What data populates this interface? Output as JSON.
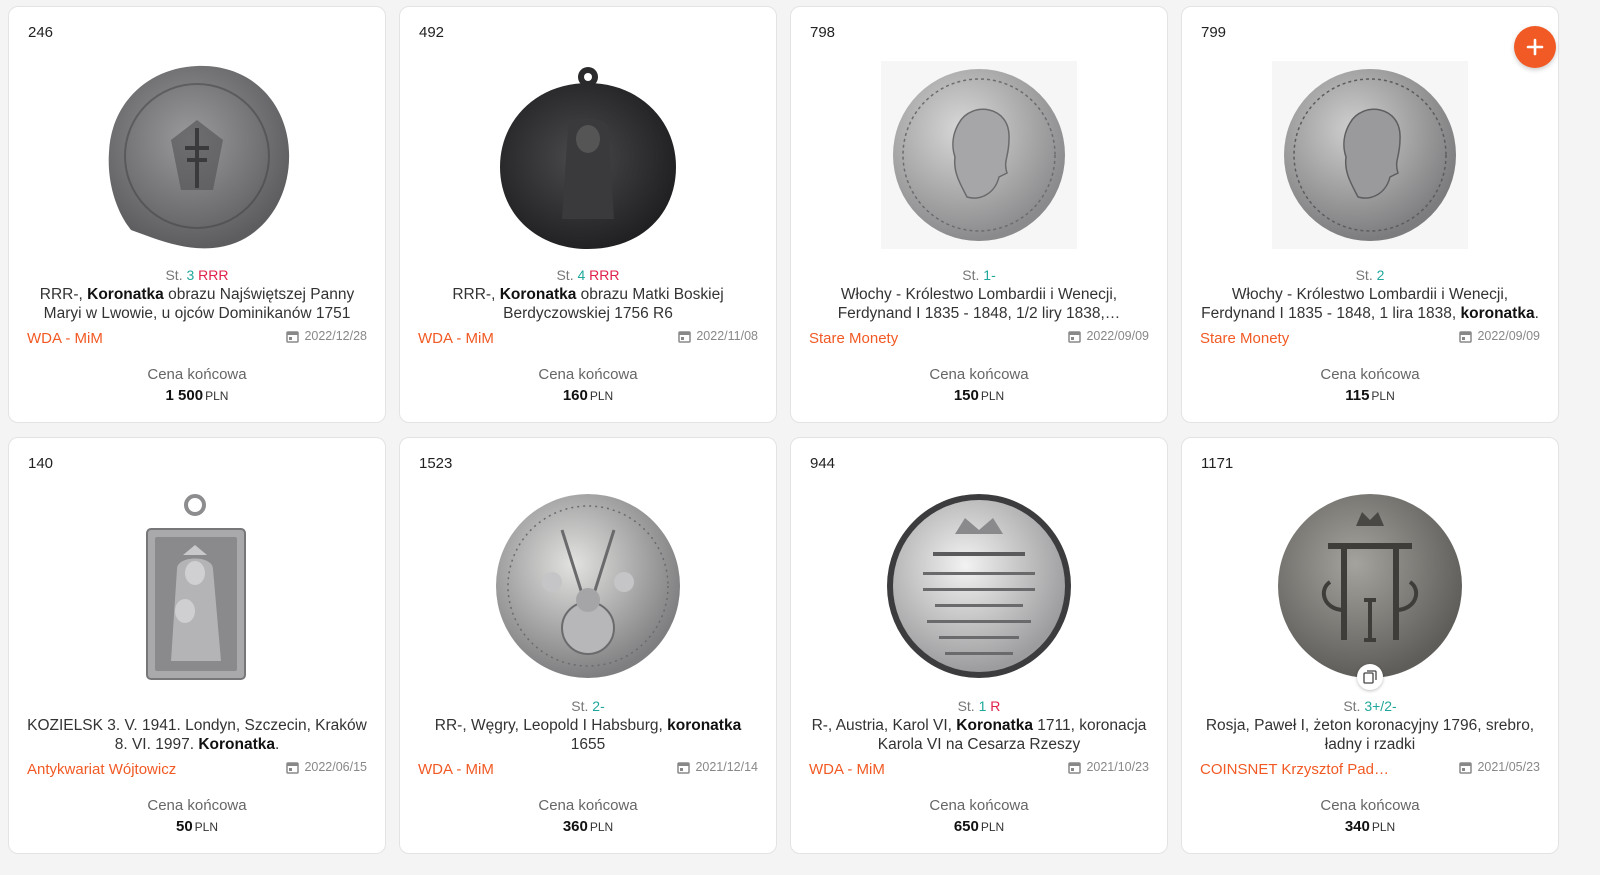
{
  "labels": {
    "price_label": "Cena końcowa",
    "state_prefix": "St.",
    "currency": "PLN"
  },
  "items": [
    {
      "lot": "246",
      "state_grade": "3",
      "state_rarity": "RRR",
      "title_pre": "RRR-, ",
      "title_bold": "Koronatka",
      "title_post": " obrazu Najświętszej Panny Maryi w Lwowie, u ojców Dominikanów 1751",
      "seller": "WDA - MiM",
      "date": "2022/12/28",
      "price": "1 500",
      "image": "grey-silver-coin-icon"
    },
    {
      "lot": "492",
      "state_grade": "4",
      "state_rarity": "RRR",
      "title_pre": "RRR-, ",
      "title_bold": "Koronatka",
      "title_post": " obrazu Matki Boskiej Berdyczowskiej 1756 R6",
      "seller": "WDA - MiM",
      "date": "2022/11/08",
      "price": "160",
      "image": "dark-medal-icon"
    },
    {
      "lot": "798",
      "state_grade": "1-",
      "state_rarity": "",
      "title_pre": "Włochy - Królestwo Lombardii i Wenecji, Ferdynand I 1835 - 1848, 1/2 liry 1838,…",
      "title_bold": "",
      "title_post": "",
      "seller": "Stare Monety",
      "date": "2022/09/09",
      "price": "150",
      "image": "silver-portrait-coin-icon"
    },
    {
      "lot": "799",
      "state_grade": "2",
      "state_rarity": "",
      "title_pre": "Włochy - Królestwo Lombardii i Wenecji, Ferdynand I 1835 - 1848, 1 lira 1838, ",
      "title_bold": "koronatka",
      "title_post": ".",
      "seller": "Stare Monety",
      "date": "2022/09/09",
      "price": "115",
      "image": "silver-portrait-coin-icon"
    },
    {
      "lot": "140",
      "state_grade": "",
      "state_rarity": "",
      "title_pre": "KOZIELSK 3. V. 1941. Londyn, Szczecin, Kraków 8. VI. 1997. ",
      "title_bold": "Koronatka",
      "title_post": ".",
      "seller": "Antykwariat Wójtowicz",
      "date": "2022/06/15",
      "price": "50",
      "image": "rectangular-pendant-icon"
    },
    {
      "lot": "1523",
      "state_grade": "2-",
      "state_rarity": "",
      "title_pre": "RR-, Węgry, Leopold I Habsburg, ",
      "title_bold": "koronatka",
      "title_post": " 1655",
      "seller": "WDA - MiM",
      "date": "2021/12/14",
      "price": "360",
      "image": "silver-globe-coin-icon"
    },
    {
      "lot": "944",
      "state_grade": "1",
      "state_rarity": "R",
      "title_pre": "R-, Austria, Karol VI, ",
      "title_bold": "Koronatka",
      "title_post": " 1711, koronacja Karola VI na Cesarza Rzeszy",
      "seller": "WDA - MiM",
      "date": "2021/10/23",
      "price": "650",
      "image": "silver-text-coin-icon"
    },
    {
      "lot": "1171",
      "state_grade": "3+/2-",
      "state_rarity": "",
      "title_pre": "Rosja, Paweł I, żeton koronacyjny 1796, srebro, ładny i rzadki",
      "title_bold": "",
      "title_post": "",
      "seller": "COINSNET Krzysztof Padzi...",
      "date": "2021/05/23",
      "price": "340",
      "image": "pi-monogram-coin-icon"
    }
  ],
  "fab": {
    "icon": "plus-icon"
  },
  "colors": {
    "accent": "#f15a24",
    "grade": "#1fa79b",
    "rarity": "#e0224a"
  }
}
